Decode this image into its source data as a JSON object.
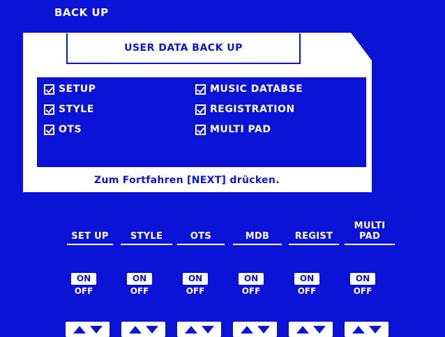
{
  "header": {
    "title": "BACK UP"
  },
  "dialog": {
    "title": "USER DATA BACK UP",
    "options": [
      {
        "label": "SETUP",
        "checked": true
      },
      {
        "label": "STYLE",
        "checked": true
      },
      {
        "label": "OTS",
        "checked": true
      },
      {
        "label": "MUSIC DATABSE",
        "checked": true
      },
      {
        "label": "REGISTRATION",
        "checked": true
      },
      {
        "label": "MULTI PAD",
        "checked": true
      }
    ],
    "hint": "Zum Fortfahren [NEXT] drücken."
  },
  "columns": [
    {
      "label": "SET UP",
      "on": "ON",
      "off": "OFF",
      "state": "on"
    },
    {
      "label": "STYLE",
      "on": "ON",
      "off": "OFF",
      "state": "on"
    },
    {
      "label": "OTS",
      "on": "ON",
      "off": "OFF",
      "state": "on"
    },
    {
      "label": "MDB",
      "on": "ON",
      "off": "OFF",
      "state": "on"
    },
    {
      "label": "REGIST",
      "on": "ON",
      "off": "OFF",
      "state": "on"
    },
    {
      "label": "MULTI\nPAD",
      "on": "ON",
      "off": "OFF",
      "state": "on"
    }
  ],
  "colors": {
    "background": "#0b14d6",
    "panel": "#ffffff"
  },
  "icons": {
    "checkbox": "checked-checkbox-icon",
    "up": "up-triangle-icon",
    "down": "down-triangle-icon"
  }
}
